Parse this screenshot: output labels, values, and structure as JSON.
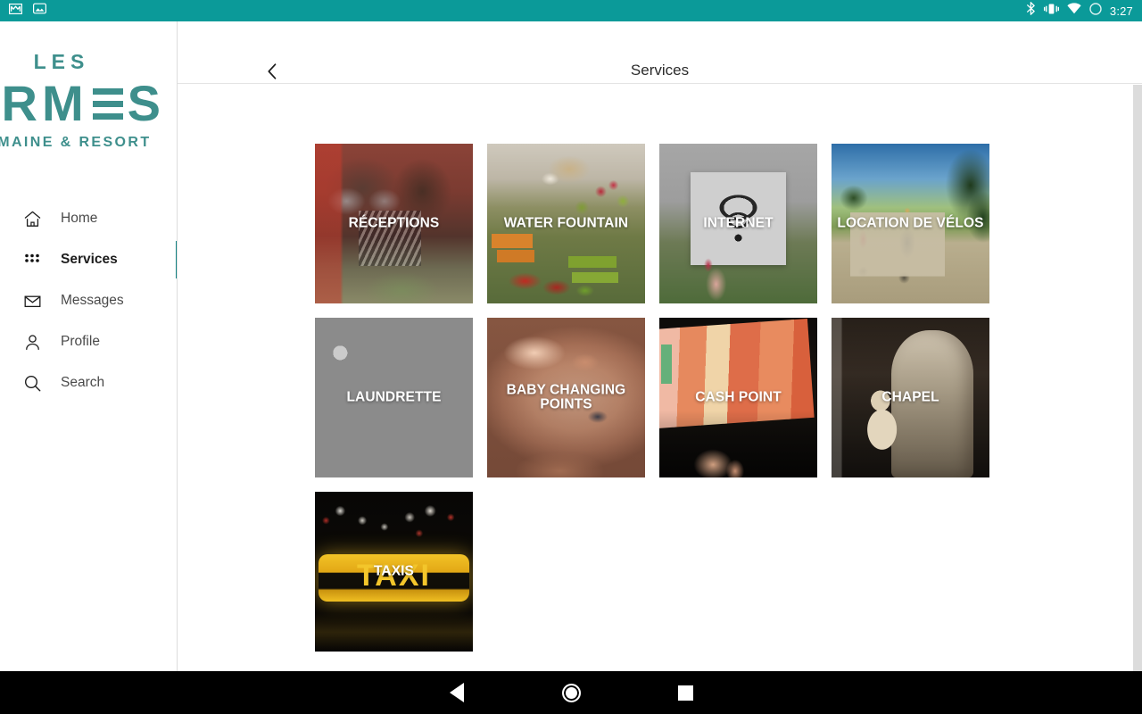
{
  "status_bar": {
    "time": "3:27",
    "left_icons": [
      "gmail-icon",
      "screenshot-icon"
    ],
    "right_icons": [
      "bluetooth-icon",
      "vibrate-icon",
      "wifi-icon",
      "battery-icon"
    ],
    "background_color": "#0B9A99"
  },
  "brand": {
    "line1": "LES",
    "line2_left": "ORM",
    "line2_right": "S",
    "line3": "DOMAINE & RESORT",
    "color": "#3E8F8C"
  },
  "sidebar": {
    "items": [
      {
        "label": "Home",
        "icon": "home-icon",
        "active": false
      },
      {
        "label": "Services",
        "icon": "grid-icon",
        "active": true
      },
      {
        "label": "Messages",
        "icon": "envelope-icon",
        "active": false
      },
      {
        "label": "Profile",
        "icon": "person-icon",
        "active": false
      },
      {
        "label": "Search",
        "icon": "search-icon",
        "active": false
      }
    ],
    "active_indicator_color": "#128283"
  },
  "header": {
    "title": "Services",
    "back_icon": "chevron-left-icon"
  },
  "services": [
    {
      "title": "RÉCEPTIONS",
      "photo": "reception-desk-photo",
      "photo_class": "ph-receptions"
    },
    {
      "title": "WATER FOUNTAIN",
      "photo": "market-produce-photo",
      "photo_class": "ph-market"
    },
    {
      "title": "INTERNET",
      "photo": "wifi-sign-photo",
      "photo_class": "ph-internet"
    },
    {
      "title": "LOCATION DE VÉLOS",
      "photo": "cyclists-path-photo",
      "photo_class": "ph-velos"
    },
    {
      "title": "LAUNDRETTE",
      "photo": "rolled-towels-photo",
      "photo_class": "ph-towels"
    },
    {
      "title": "BABY CHANGING POINTS",
      "photo": "baby-closeup-photo",
      "photo_class": "ph-baby"
    },
    {
      "title": "CASH POINT",
      "photo": "euro-banknotes-photo",
      "photo_class": "ph-cash"
    },
    {
      "title": "CHAPEL",
      "photo": "madonna-statue-photo",
      "photo_class": "ph-chapel"
    },
    {
      "title": "TAXIS",
      "photo": "taxi-sign-photo",
      "photo_class": "ph-taxi",
      "overlay_word": "TAXI"
    }
  ],
  "navbar": {
    "back_label": "back-triangle",
    "home_label": "home-circle",
    "recents_label": "recents-square"
  }
}
